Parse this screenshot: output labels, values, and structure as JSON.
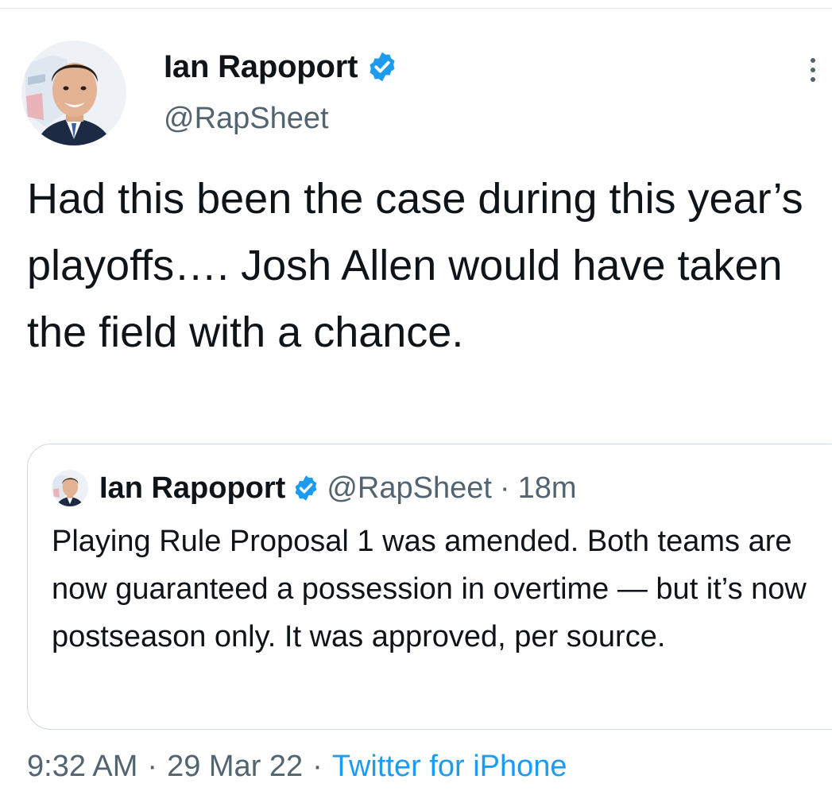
{
  "tweet": {
    "author": {
      "display_name": "Ian Rapoport",
      "handle": "@RapSheet",
      "avatar_icon": "profile-photo",
      "verified_icon": "verified-badge-icon"
    },
    "text": "Had this been the case during this year’s playoffs…. Josh Allen would have taken the field with a chance.",
    "time": "9:32 AM",
    "date": "29 Mar 22",
    "separator": "·",
    "source": "Twitter for iPhone"
  },
  "quoted_tweet": {
    "display_name": "Ian Rapoport",
    "handle": "@RapSheet",
    "separator": "·",
    "relative_time": "18m",
    "text": "Playing Rule Proposal 1 was amended. Both teams are now guaranteed a possession in overtime — but it’s now postseason only. It was approved, per source."
  },
  "colors": {
    "verified": "#1d9bf0",
    "link": "#1d9bf0",
    "secondary_text": "#536471",
    "border": "#cfd9de"
  }
}
